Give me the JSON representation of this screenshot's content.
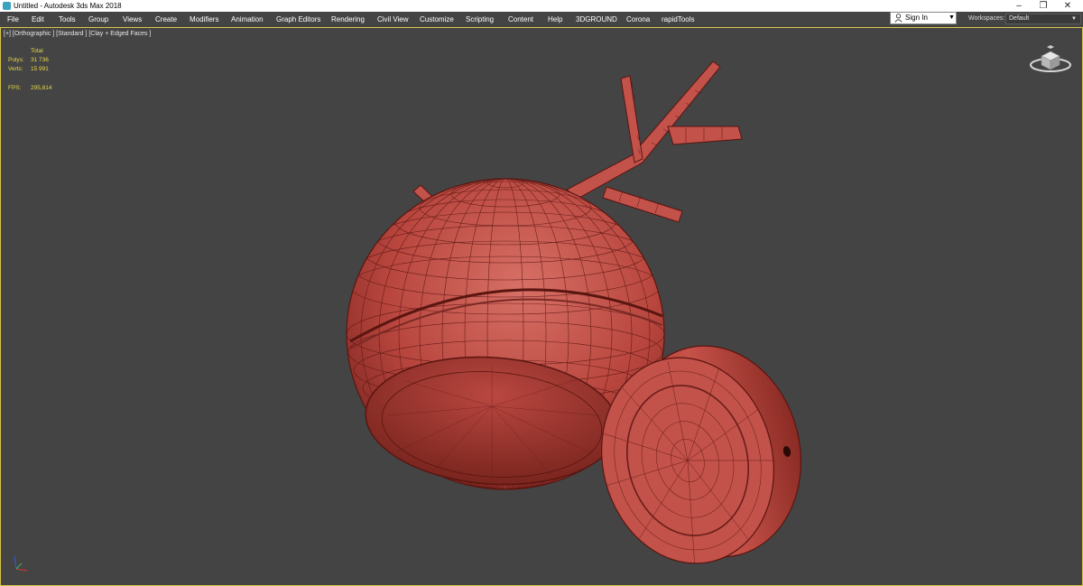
{
  "window": {
    "title": "Untitled - Autodesk 3ds Max 2018",
    "app_icon": "3ds-max-icon",
    "controls": [
      "minimize-icon",
      "restore-icon",
      "close-icon"
    ]
  },
  "menu": {
    "items": [
      "File",
      "Edit",
      "Tools",
      "Group",
      "Views",
      "Create",
      "Modifiers",
      "Animation",
      "Graph Editors",
      "Rendering",
      "Civil View",
      "Customize",
      "Scripting",
      "Content",
      "Help",
      "3DGROUND",
      "Corona",
      "rapidTools"
    ]
  },
  "account": {
    "sign_in": "Sign In",
    "icon": "user-icon"
  },
  "workspaces": {
    "label": "Workspaces:",
    "value": "Default"
  },
  "viewport": {
    "label": "[+] [Orthographic ] [Standard ] [Clay + Edged Faces ]",
    "stats": {
      "header": "Total",
      "polys_label": "Polys:",
      "polys_value": "31 736",
      "verts_label": "Verts:",
      "verts_value": "15 991",
      "fps_label": "FPS:",
      "fps_value": "295,814"
    },
    "model_color": "#c2524a",
    "wire_color": "#5a1510",
    "border_color": "#d9c64a",
    "background_color": "#444444"
  }
}
